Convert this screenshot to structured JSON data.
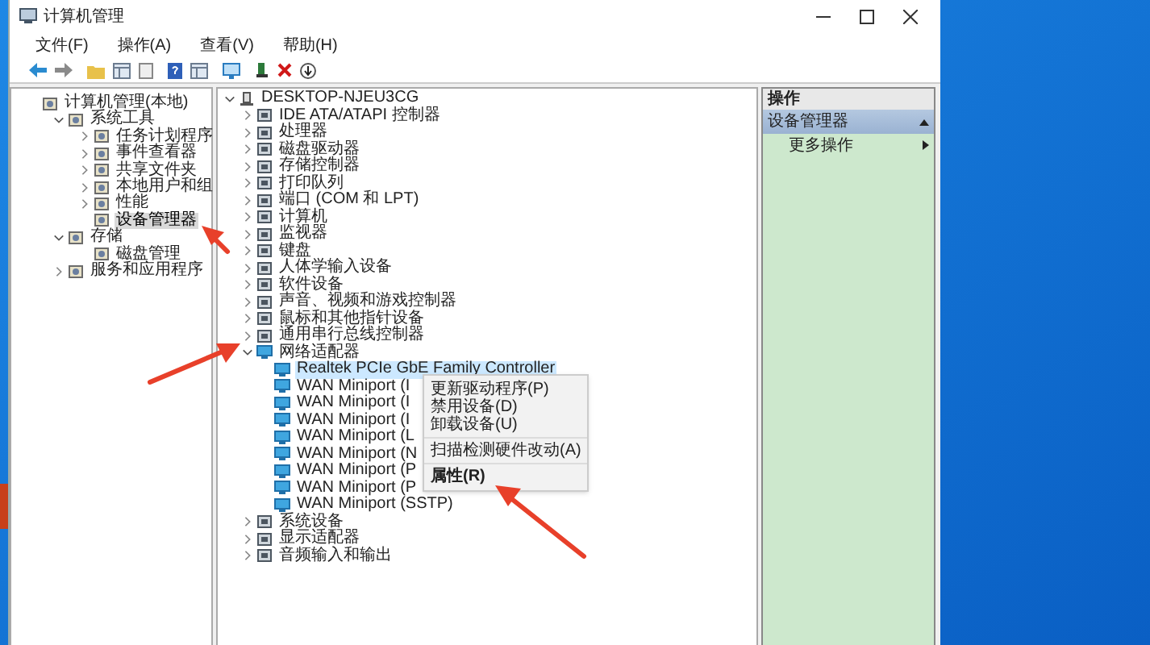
{
  "window": {
    "title": "计算机管理"
  },
  "menu": [
    {
      "label": "文件(F)"
    },
    {
      "label": "操作(A)"
    },
    {
      "label": "查看(V)"
    },
    {
      "label": "帮助(H)"
    }
  ],
  "left_tree": [
    {
      "label": "计算机管理(本地)",
      "selected": false,
      "children": [
        {
          "label": "系统工具",
          "expanded": true,
          "selected": false,
          "children": [
            {
              "label": "任务计划程序",
              "expanded": false,
              "selected": false
            },
            {
              "label": "事件查看器",
              "expanded": false,
              "selected": false
            },
            {
              "label": "共享文件夹",
              "expanded": false,
              "selected": false
            },
            {
              "label": "本地用户和组",
              "expanded": false,
              "selected": false
            },
            {
              "label": "性能",
              "expanded": false,
              "selected": false
            },
            {
              "label": "设备管理器",
              "selected": true
            }
          ]
        },
        {
          "label": "存储",
          "expanded": true,
          "selected": false,
          "children": [
            {
              "label": "磁盘管理",
              "selected": false
            }
          ]
        },
        {
          "label": "服务和应用程序",
          "expanded": false,
          "selected": false
        }
      ]
    }
  ],
  "device_tree": {
    "label": "DESKTOP-NJEU3CG",
    "expanded": true,
    "children": [
      {
        "label": "IDE ATA/ATAPI 控制器",
        "expanded": false
      },
      {
        "label": "处理器",
        "expanded": false
      },
      {
        "label": "磁盘驱动器",
        "expanded": false
      },
      {
        "label": "存储控制器",
        "expanded": false
      },
      {
        "label": "打印队列",
        "expanded": false
      },
      {
        "label": "端口 (COM 和 LPT)",
        "expanded": false
      },
      {
        "label": "计算机",
        "expanded": false
      },
      {
        "label": "监视器",
        "expanded": false
      },
      {
        "label": "键盘",
        "expanded": false
      },
      {
        "label": "人体学输入设备",
        "expanded": false
      },
      {
        "label": "软件设备",
        "expanded": false
      },
      {
        "label": "声音、视频和游戏控制器",
        "expanded": false
      },
      {
        "label": "鼠标和其他指针设备",
        "expanded": false
      },
      {
        "label": "通用串行总线控制器",
        "expanded": false
      },
      {
        "label": "网络适配器",
        "expanded": true,
        "children": [
          {
            "label": "Realtek PCIe GbE Family Controller",
            "selected": true
          },
          {
            "label": "WAN Miniport (I",
            "selected": false
          },
          {
            "label": "WAN Miniport (I",
            "selected": false
          },
          {
            "label": "WAN Miniport (I",
            "selected": false
          },
          {
            "label": "WAN Miniport (L",
            "selected": false
          },
          {
            "label": "WAN Miniport (N",
            "selected": false
          },
          {
            "label": "WAN Miniport (P",
            "selected": false
          },
          {
            "label": "WAN Miniport (P",
            "selected": false
          },
          {
            "label": "WAN Miniport (SSTP)",
            "selected": false
          }
        ]
      },
      {
        "label": "系统设备",
        "expanded": false
      },
      {
        "label": "显示适配器",
        "expanded": false
      },
      {
        "label": "音频输入和输出",
        "expanded": false
      }
    ]
  },
  "context_menu": {
    "groups": [
      {
        "items": [
          {
            "label": "更新驱动程序(P)",
            "default": false
          },
          {
            "label": "禁用设备(D)",
            "default": false
          },
          {
            "label": "卸载设备(U)",
            "default": false
          }
        ]
      },
      {
        "items": [
          {
            "label": "扫描检测硬件改动(A)",
            "default": false
          }
        ]
      },
      {
        "items": [
          {
            "label": "属性(R)",
            "default": true
          }
        ]
      }
    ]
  },
  "actions": {
    "title": "操作",
    "section": {
      "label": "设备管理器",
      "expanded": true
    },
    "items": [
      {
        "label": "更多操作"
      }
    ]
  }
}
